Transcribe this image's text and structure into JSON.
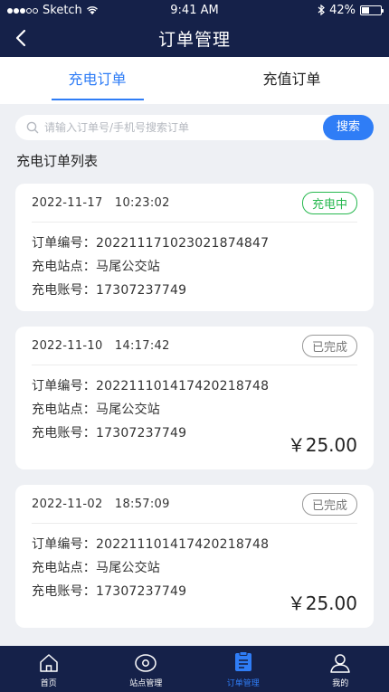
{
  "status_bar": {
    "carrier": "Sketch",
    "time": "9:41 AM",
    "battery": "42%",
    "battery_level": 0.42
  },
  "header": {
    "title": "订单管理"
  },
  "tabs": [
    {
      "label": "充电订单",
      "active": true
    },
    {
      "label": "充值订单",
      "active": false
    }
  ],
  "search": {
    "placeholder": "请输入订单号/手机号搜索订单",
    "button": "搜索"
  },
  "section_title": "充电订单列表",
  "field_labels": {
    "order_no": "订单编号：",
    "station": "充电站点：",
    "account": "充电账号："
  },
  "orders": [
    {
      "date": "2022-11-17",
      "time": "10:23:02",
      "status": "充电中",
      "order_no": "20221117102302187484​7",
      "station": "马尾公交站",
      "account": "17307237749",
      "amount": ""
    },
    {
      "date": "2022-11-10",
      "time": "14:17:42",
      "status": "已完成",
      "order_no": "20221110141742021874​8",
      "station": "马尾公交站",
      "account": "17307237749",
      "amount": "￥25.00"
    },
    {
      "date": "2022-11-02",
      "time": "18:57:09",
      "status": "已完成",
      "order_no": "20221110141742021874​8",
      "station": "马尾公交站",
      "account": "17307237749",
      "amount": "￥25.00"
    }
  ],
  "tabbar": [
    {
      "label": "首页",
      "icon": "home-icon",
      "active": false
    },
    {
      "label": "站点管理",
      "icon": "location-icon",
      "active": false
    },
    {
      "label": "订单管理",
      "icon": "order-icon",
      "active": true
    },
    {
      "label": "我的",
      "icon": "user-icon",
      "active": false
    }
  ],
  "colors": {
    "nav": "#152149",
    "accent": "#2f7df6",
    "charging": "#27b84f"
  }
}
